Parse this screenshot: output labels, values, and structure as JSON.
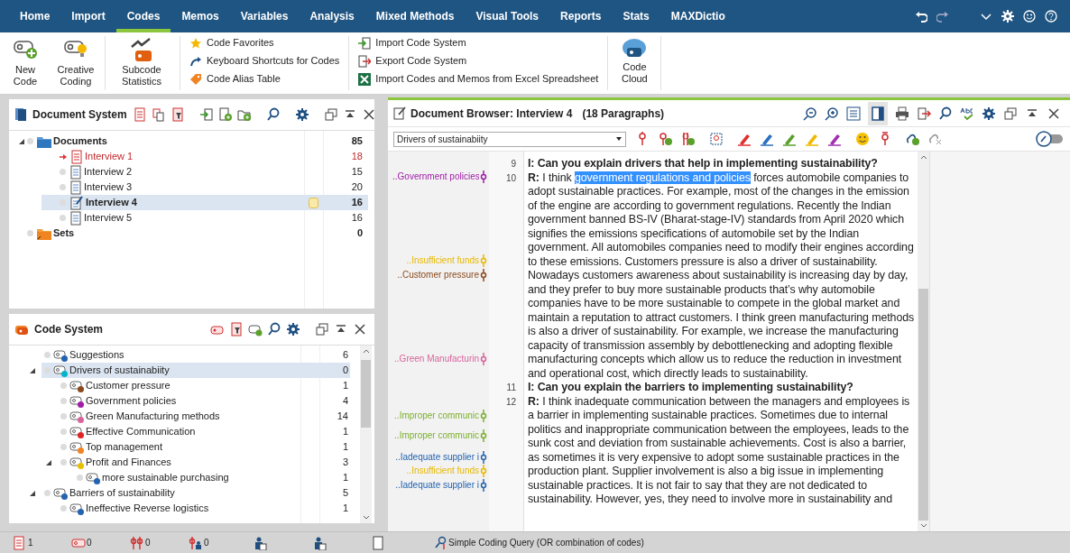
{
  "menu": [
    {
      "label": "Home",
      "selected": false
    },
    {
      "label": "Import",
      "selected": false
    },
    {
      "label": "Codes",
      "selected": true
    },
    {
      "label": "Memos",
      "selected": false
    },
    {
      "label": "Variables",
      "selected": false
    },
    {
      "label": "Analysis",
      "selected": false
    },
    {
      "label": "Mixed Methods",
      "selected": false
    },
    {
      "label": "Visual Tools",
      "selected": false
    },
    {
      "label": "Reports",
      "selected": false
    },
    {
      "label": "Stats",
      "selected": false
    },
    {
      "label": "MAXDictio",
      "selected": false
    }
  ],
  "ribbon": {
    "big_buttons": [
      {
        "label": "New Code",
        "kind": "new-code"
      },
      {
        "label": "Creative Coding",
        "kind": "creative"
      },
      {
        "label": "Subcode Statistics",
        "kind": "subcode"
      }
    ],
    "small_group_1": [
      {
        "label": "Code Favorites",
        "kind": "star"
      },
      {
        "label": "Keyboard Shortcuts for Codes",
        "kind": "shortcut"
      },
      {
        "label": "Code Alias Table",
        "kind": "tag"
      }
    ],
    "small_group_2": [
      {
        "label": "Import Code System",
        "kind": "import"
      },
      {
        "label": "Export Code System",
        "kind": "export"
      },
      {
        "label": "Import Codes and Memos from Excel Spreadsheet",
        "kind": "excel"
      }
    ],
    "cloud_button": {
      "label": "Code Cloud"
    }
  },
  "document_system": {
    "title": "Document System",
    "items": [
      {
        "name": "Documents",
        "kind": "folder",
        "count": "85",
        "expanded": true,
        "children": [
          {
            "name": "Interview 1",
            "kind": "doc",
            "count": "18",
            "activated": true,
            "selected": false,
            "memo": false
          },
          {
            "name": "Interview 2",
            "kind": "doc",
            "count": "15",
            "activated": false,
            "selected": false,
            "memo": false
          },
          {
            "name": "Interview 3",
            "kind": "doc",
            "count": "20",
            "activated": false,
            "selected": false,
            "memo": false
          },
          {
            "name": "Interview 4",
            "kind": "doc-open",
            "count": "16",
            "activated": false,
            "selected": true,
            "memo": true
          },
          {
            "name": "Interview 5",
            "kind": "doc",
            "count": "16",
            "activated": false,
            "selected": false,
            "memo": false
          }
        ]
      },
      {
        "name": "Sets",
        "kind": "set",
        "count": "0"
      }
    ]
  },
  "code_system": {
    "title": "Code System",
    "items": [
      {
        "name": "Suggestions",
        "color": "#2463b0",
        "count": "6",
        "selected": false
      },
      {
        "name": "Drivers of sustainabiity",
        "color": "#00b4cc",
        "count": "0",
        "selected": true,
        "expanded": true,
        "children": [
          {
            "name": "Customer pressure",
            "color": "#8b4a1c",
            "count": "1",
            "selected": false
          },
          {
            "name": "Government policies",
            "color": "#a01ea8",
            "count": "4",
            "selected": false
          },
          {
            "name": "Green Manufacturing methods",
            "color": "#d8649c",
            "count": "14",
            "selected": false
          },
          {
            "name": "Effective Communication",
            "color": "#e02424",
            "count": "1",
            "selected": false
          },
          {
            "name": "Top management",
            "color": "#f08424",
            "count": "1",
            "selected": false
          },
          {
            "name": "Profit and Finances",
            "color": "#e8c000",
            "count": "3",
            "selected": false,
            "expanded": true,
            "children": [
              {
                "name": "more sustainable purchasing",
                "color": "#2463b0",
                "count": "1",
                "selected": false
              }
            ]
          }
        ]
      },
      {
        "name": "Barriers of sustainability",
        "color": "#2463b0",
        "count": "5",
        "selected": false,
        "expanded": true,
        "children": [
          {
            "name": "Ineffective Reverse logistics",
            "color": "#2463b0",
            "count": "1",
            "selected": false
          }
        ]
      }
    ]
  },
  "document_browser": {
    "title": "Document Browser: Interview 4",
    "paragraph_count": "(18 Paragraphs)",
    "code_dropdown": "Drivers of sustainabiity",
    "margin_codes": [
      {
        "label": "..Government policies",
        "color": "#a01ea8"
      },
      {
        "label": "..Insufficient funds",
        "color": "#e8b800"
      },
      {
        "label": "..Customer pressure",
        "color": "#8b4a1c"
      },
      {
        "label": "..Green Manufacturin",
        "color": "#d8649c"
      },
      {
        "label": "..Improper communic",
        "color": "#7cb02c"
      },
      {
        "label": "..Improper communic",
        "color": "#7cb02c"
      },
      {
        "label": "..Iadequate supplier i",
        "color": "#2463b0"
      },
      {
        "label": "..Insufficient funds",
        "color": "#e8b800"
      },
      {
        "label": "..Iadequate supplier i",
        "color": "#2463b0"
      }
    ],
    "paragraphs": [
      {
        "number": "9",
        "speaker": "I:",
        "text": "Can you explain drivers that help in implementing sustainability?",
        "kind": "question"
      },
      {
        "number": "10",
        "speaker": "R:",
        "before": "I think",
        "highlight": "government regulations and policies",
        "text": "forces automobile companies to adopt sustainable practices. For example, most of the changes in the emission of the engine are according to government regulations. Recently the Indian government banned BS-IV (Bharat-stage-IV) standards from April 2020 which signifies the emissions specifications of automobile set by the Indian government. All automobiles companies need to modify their engines according to these emissions. Customers pressure is also a driver of sustainability. Nowadays customers awareness about sustainability is increasing day by day, and they prefer to buy more sustainable products that’s why automobile companies have to be more sustainable to compete in the global market and maintain a reputation to attract customers. I think green manufacturing methods is also a driver of sustainability. For example, we increase the manufacturing capacity of transmission assembly by debottlenecking and adopting flexible manufacturing concepts which allow us to reduce the reduction in investment and operational cost, which directly leads to sustainability.",
        "kind": "answer"
      },
      {
        "number": "11",
        "speaker": "I:",
        "text": "Can you explain the barriers to implementing sustainability?",
        "kind": "question"
      },
      {
        "number": "12",
        "speaker": "R:",
        "text": "I think inadequate communication between the managers and employees is a barrier in implementing sustainable practices. Sometimes due to internal politics and inappropriate communication between the employees, leads to the sunk cost and deviation from sustainable achievements. Cost is also a barrier, as sometimes it is very expensive to adopt some sustainable practices in the production plant. Supplier involvement is also a big issue in implementing sustainable practices. It is not fair to say that they are not dedicated to sustainability. However, yes, they need to involve more in sustainability and",
        "kind": "answer"
      }
    ]
  },
  "status_bar": {
    "counters": [
      {
        "kind": "documents",
        "value": "1"
      },
      {
        "kind": "codes",
        "value": "0"
      },
      {
        "kind": "segments",
        "value": "0"
      },
      {
        "kind": "users",
        "value": "0"
      }
    ],
    "query": "Simple Coding Query (OR combination of codes)"
  }
}
